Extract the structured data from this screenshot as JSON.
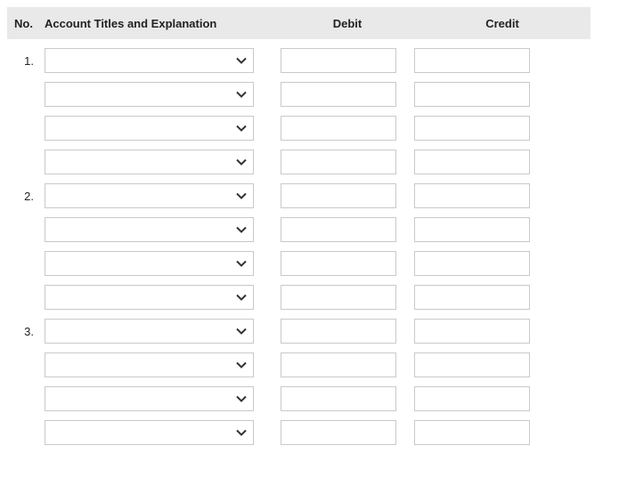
{
  "headers": {
    "no": "No.",
    "account": "Account Titles and Explanation",
    "debit": "Debit",
    "credit": "Credit"
  },
  "rows": [
    {
      "num": "1.",
      "account": "",
      "debit": "",
      "credit": ""
    },
    {
      "num": "",
      "account": "",
      "debit": "",
      "credit": ""
    },
    {
      "num": "",
      "account": "",
      "debit": "",
      "credit": ""
    },
    {
      "num": "",
      "account": "",
      "debit": "",
      "credit": ""
    },
    {
      "num": "2.",
      "account": "",
      "debit": "",
      "credit": ""
    },
    {
      "num": "",
      "account": "",
      "debit": "",
      "credit": ""
    },
    {
      "num": "",
      "account": "",
      "debit": "",
      "credit": ""
    },
    {
      "num": "",
      "account": "",
      "debit": "",
      "credit": ""
    },
    {
      "num": "3.",
      "account": "",
      "debit": "",
      "credit": ""
    },
    {
      "num": "",
      "account": "",
      "debit": "",
      "credit": ""
    },
    {
      "num": "",
      "account": "",
      "debit": "",
      "credit": ""
    },
    {
      "num": "",
      "account": "",
      "debit": "",
      "credit": ""
    }
  ]
}
